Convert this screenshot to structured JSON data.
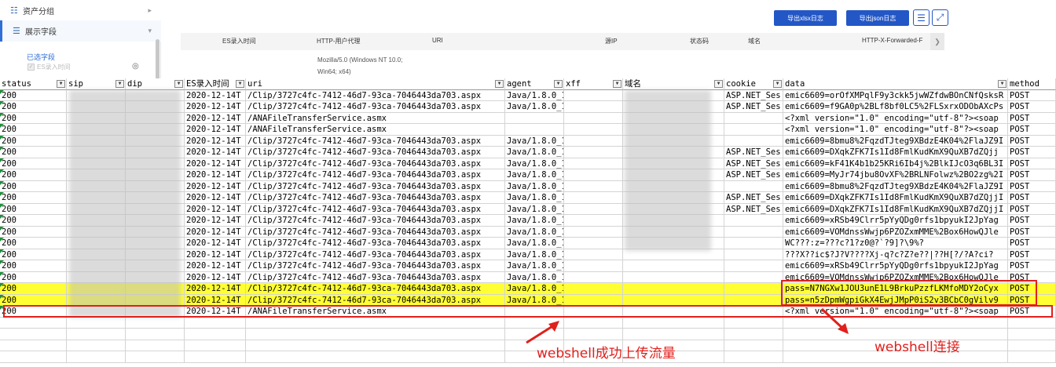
{
  "panel": {
    "group_label": "资产分组",
    "fields_label": "展示字段",
    "selected_title": "已选字段",
    "selected_item": "ES录入时间"
  },
  "toolbar": {
    "export_xlsx": "导出xlsx日志",
    "export_json": "导出json日志"
  },
  "header_strip": [
    "ES录入时间",
    "HTTP-用户代理",
    "URI",
    "源IP",
    "状态码",
    "域名",
    "HTTP-X-Forwarded-F"
  ],
  "agent_preview": [
    "Mozilla/5.0 (Windows NT 10.0;",
    "Win64; x64)"
  ],
  "sheet": {
    "columns": [
      "status",
      "sip",
      "dip",
      "ES录入时间",
      "uri",
      "agent",
      "xff",
      "域名",
      "cookie",
      "data",
      "method"
    ],
    "rows": [
      {
        "status": "200",
        "es": "2020-12-14T",
        "uri": "/Clip/3727c4fc-7412-46d7-93ca-7046443da703.aspx",
        "agent": "Java/1.8.0_172",
        "cookie": "ASP.NET_Ses",
        "data": "emic6609=orOfXMPqlF9y3ckk5jwWZfdwBOnCNfQsksR",
        "method": "POST",
        "hl": false
      },
      {
        "status": "200",
        "es": "2020-12-14T",
        "uri": "/Clip/3727c4fc-7412-46d7-93ca-7046443da703.aspx",
        "agent": "Java/1.8.0_172",
        "cookie": "ASP.NET_Ses",
        "data": "emic6609=f9GA0p%2BLf8bf0LC5%2FLSxrxODObAXcPs",
        "method": "POST",
        "hl": false
      },
      {
        "status": "200",
        "es": "2020-12-14T",
        "uri": "/ANAFileTransferService.asmx",
        "agent": "",
        "cookie": "",
        "data": "<?xml version=\"1.0\" encoding=\"utf-8\"?><soap",
        "method": "POST",
        "hl": false
      },
      {
        "status": "200",
        "es": "2020-12-14T",
        "uri": "/ANAFileTransferService.asmx",
        "agent": "",
        "cookie": "",
        "data": "<?xml version=\"1.0\" encoding=\"utf-8\"?><soap",
        "method": "POST",
        "hl": false
      },
      {
        "status": "200",
        "es": "2020-12-14T",
        "uri": "/Clip/3727c4fc-7412-46d7-93ca-7046443da703.aspx",
        "agent": "Java/1.8.0_172",
        "cookie": "",
        "data": "emic6609=8bmu8%2FqzdTJteg9XBdzE4K04%2FlaJZ9I",
        "method": "POST",
        "hl": false
      },
      {
        "status": "200",
        "es": "2020-12-14T",
        "uri": "/Clip/3727c4fc-7412-46d7-93ca-7046443da703.aspx",
        "agent": "Java/1.8.0_172",
        "cookie": "ASP.NET_Ses",
        "data": "emic6609=DXqkZFK7Is1Id8FmlKudKmX9QuXB7dZQjj",
        "method": "POST",
        "hl": false
      },
      {
        "status": "200",
        "es": "2020-12-14T",
        "uri": "/Clip/3727c4fc-7412-46d7-93ca-7046443da703.aspx",
        "agent": "Java/1.8.0_172",
        "cookie": "ASP.NET_Ses",
        "data": "emic6609=kF41K4b1b25KRi6Ib4j%2BlkIJcO3q6BL3I",
        "method": "POST",
        "hl": false
      },
      {
        "status": "200",
        "es": "2020-12-14T",
        "uri": "/Clip/3727c4fc-7412-46d7-93ca-7046443da703.aspx",
        "agent": "Java/1.8.0_172",
        "cookie": "ASP.NET_Ses",
        "data": "emic6609=MyJr74jbu8OvXF%2BRLNFolwz%2BO2zg%2I",
        "method": "POST",
        "hl": false
      },
      {
        "status": "200",
        "es": "2020-12-14T",
        "uri": "/Clip/3727c4fc-7412-46d7-93ca-7046443da703.aspx",
        "agent": "Java/1.8.0_172",
        "cookie": "",
        "data": "emic6609=8bmu8%2FqzdTJteg9XBdzE4K04%2FlaJZ9I",
        "method": "POST",
        "hl": false
      },
      {
        "status": "200",
        "es": "2020-12-14T",
        "uri": "/Clip/3727c4fc-7412-46d7-93ca-7046443da703.aspx",
        "agent": "Java/1.8.0_172",
        "cookie": "ASP.NET_Ses",
        "data": "emic6609=DXqkZFK7Is1Id8FmlKudKmX9QuXB7dZQjjI",
        "method": "POST",
        "hl": false
      },
      {
        "status": "200",
        "es": "2020-12-14T",
        "uri": "/Clip/3727c4fc-7412-46d7-93ca-7046443da703.aspx",
        "agent": "Java/1.8.0_172",
        "cookie": "ASP.NET_Ses",
        "data": "emic6609=DXqkZFK7Is1Id8FmlKudKmX9QuXB7dZQjjI",
        "method": "POST",
        "hl": false
      },
      {
        "status": "200",
        "es": "2020-12-14T",
        "uri": "/Clip/3727c4fc-7412-46d7-93ca-7046443da703.aspx",
        "agent": "Java/1.8.0_172",
        "cookie": "",
        "data": "emic6609=xRSb49Clrr5pYyQDg0rfs1bpyukI2JpYag",
        "method": "POST",
        "hl": false
      },
      {
        "status": "200",
        "es": "2020-12-14T",
        "uri": "/Clip/3727c4fc-7412-46d7-93ca-7046443da703.aspx",
        "agent": "Java/1.8.0_172",
        "cookie": "",
        "data": "emic6609=VOMdnssWwjp6PZOZxmMME%2Box6HowQJle",
        "method": "POST",
        "hl": false
      },
      {
        "status": "200",
        "es": "2020-12-14T",
        "uri": "/Clip/3727c4fc-7412-46d7-93ca-7046443da703.aspx",
        "agent": "Java/1.8.0_172",
        "cookie": "",
        "data": "WC???:z=???c?1?z0@?`?9]?\\9%?",
        "method": "POST",
        "hl": false
      },
      {
        "status": "200",
        "es": "2020-12-14T",
        "uri": "/Clip/3727c4fc-7412-46d7-93ca-7046443da703.aspx",
        "agent": "Java/1.8.0_172",
        "cookie": "",
        "data": "???X??ic$?J?V????Xj-q?c?Z?e??|??H[?/?A?ci?",
        "method": "POST",
        "hl": false
      },
      {
        "status": "200",
        "es": "2020-12-14T",
        "uri": "/Clip/3727c4fc-7412-46d7-93ca-7046443da703.aspx",
        "agent": "Java/1.8.0_172",
        "cookie": "",
        "data": "emic6609=xRSb49Clrr5pYyQDg0rfs1bpyukI2JpYag",
        "method": "POST",
        "hl": false
      },
      {
        "status": "200",
        "es": "2020-12-14T",
        "uri": "/Clip/3727c4fc-7412-46d7-93ca-7046443da703.aspx",
        "agent": "Java/1.8.0_172",
        "cookie": "",
        "data": "emic6609=VOMdnssWwjp6PZOZxmMME%2Box6HowQJle",
        "method": "POST",
        "hl": false
      },
      {
        "status": "200",
        "es": "2020-12-14T",
        "uri": "/Clip/3727c4fc-7412-46d7-93ca-7046443da703.aspx",
        "agent": "Java/1.8.0_172",
        "cookie": "",
        "data": "pass=N7NGXw1JOU3unE1L9BrkuPzzfLKMfoMDY2oCyx",
        "method": "POST",
        "hl": true
      },
      {
        "status": "200",
        "es": "2020-12-14T",
        "uri": "/Clip/3727c4fc-7412-46d7-93ca-7046443da703.aspx",
        "agent": "Java/1.8.0_172",
        "cookie": "",
        "data": "pass=n5zDpmWgpiGkX4EwjJMpP0iS2v3BCbC0gVilv9",
        "method": "POST",
        "hl": true
      },
      {
        "status": "200",
        "es": "2020-12-14T",
        "uri": "/ANAFileTransferService.asmx",
        "agent": "",
        "cookie": "",
        "data": "<?xml version=\"1.0\" encoding=\"utf-8\"?><soap",
        "method": "POST",
        "hl": false
      }
    ]
  },
  "annotations": {
    "upload_traffic": "webshell成功上传流量",
    "connection": "webshell连接"
  },
  "colors": {
    "highlight": "#ffff33",
    "annotation": "#e0201c",
    "accent": "#2357c6"
  }
}
